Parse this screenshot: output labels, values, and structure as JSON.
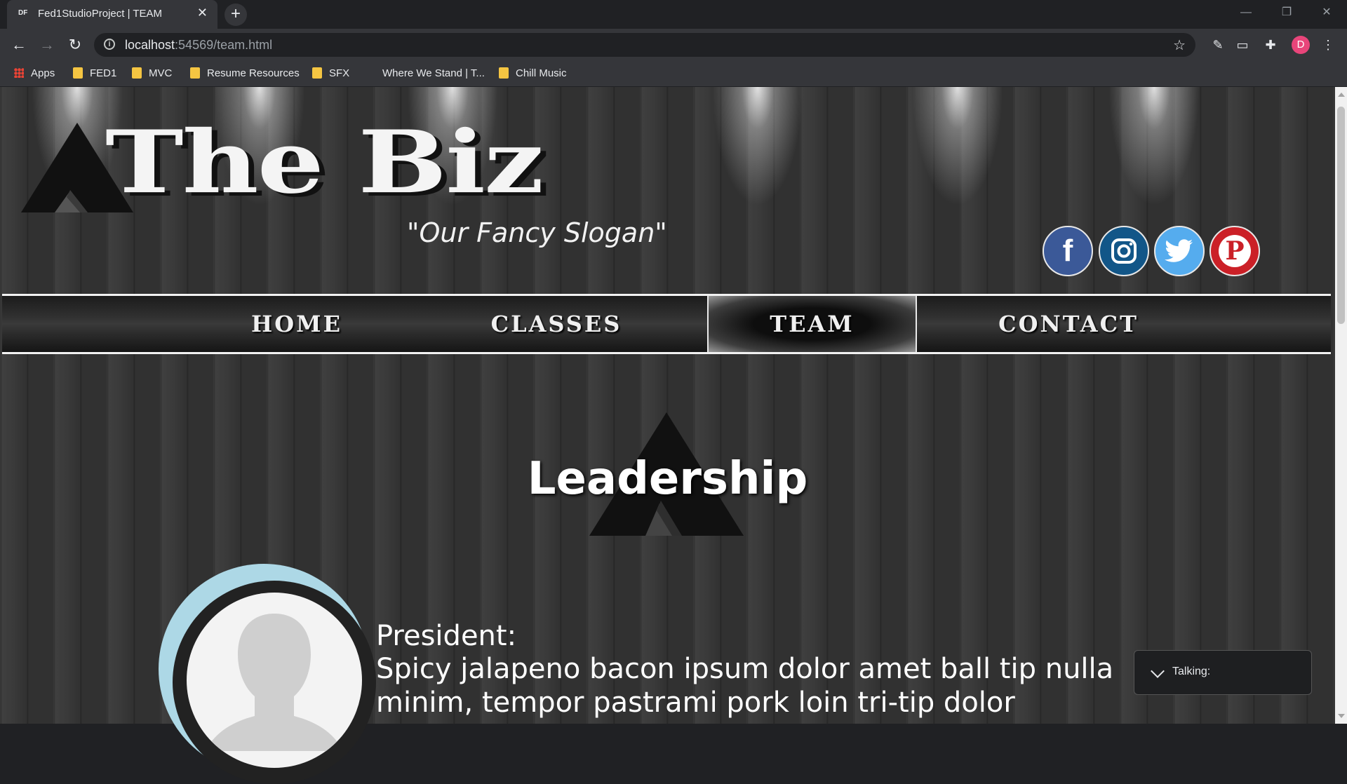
{
  "browser": {
    "tab_favicon": "DF",
    "tab_title": "Fed1StudioProject | TEAM",
    "tab_close": "✕",
    "new_tab": "+",
    "window_controls": {
      "minimize": "—",
      "restore": "❐",
      "close": "✕"
    },
    "nav": {
      "back": "←",
      "forward": "→",
      "reload": "↻"
    },
    "address": {
      "host": "localhost",
      "rest": ":54569/team.html",
      "star": "☆"
    },
    "profile_initial": "D",
    "bookmarks": [
      "Apps",
      "FED1",
      "MVC",
      "Resume Resources",
      "SFX",
      "Where We Stand | T...",
      "Chill Music"
    ]
  },
  "site": {
    "brand": "The Biz",
    "slogan": "\"Our Fancy Slogan\"",
    "social": [
      {
        "name": "facebook",
        "glyph": "f",
        "color": "#3b5998"
      },
      {
        "name": "instagram",
        "glyph": "◎",
        "color": "#125688"
      },
      {
        "name": "twitter",
        "glyph": "🐦",
        "color": "#55acee"
      },
      {
        "name": "pinterest",
        "glyph": "P",
        "color": "#cb2027"
      }
    ],
    "nav": [
      "HOME",
      "CLASSES",
      "TEAM",
      "CONTACT"
    ],
    "active_nav": "TEAM",
    "section_title": "Leadership",
    "member": {
      "role": "President:",
      "bio": "Spicy jalapeno bacon ipsum dolor amet ball tip nulla minim, tempor pastrami pork loin tri-tip dolor"
    }
  },
  "widget": {
    "label": "Talking:"
  }
}
